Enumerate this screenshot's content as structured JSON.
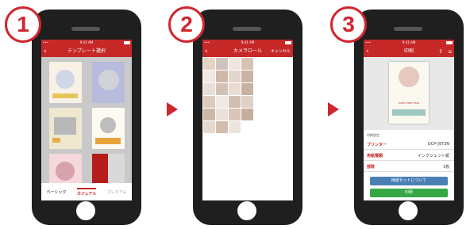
{
  "steps": [
    "1",
    "2",
    "3"
  ],
  "screen1": {
    "time": "9:41 AM",
    "title": "テンプレート選択",
    "tabs": [
      "ベーシック",
      "カジュアル",
      "プレミアム"
    ],
    "active_tab": "カジュアル"
  },
  "screen2": {
    "time": "9:41 AM",
    "title": "カメラロール",
    "cancel": "キャンセル"
  },
  "screen3": {
    "time": "9:41 AM",
    "title": "印刷",
    "section_label": "印刷設定",
    "rows": [
      {
        "label": "プリンター",
        "value": "DCP-J973N"
      },
      {
        "label": "用紙種類",
        "value": "インクジェット紙"
      },
      {
        "label": "部数",
        "value": "1枚"
      }
    ],
    "blue_button": "用紙セットについて",
    "green_button": "印刷",
    "card_text": "HAPPY NEW YEAR"
  },
  "colors": {
    "accent": "#d0262f",
    "nav": "#c62828",
    "blue": "#4a7fb5",
    "green": "#35a845"
  }
}
